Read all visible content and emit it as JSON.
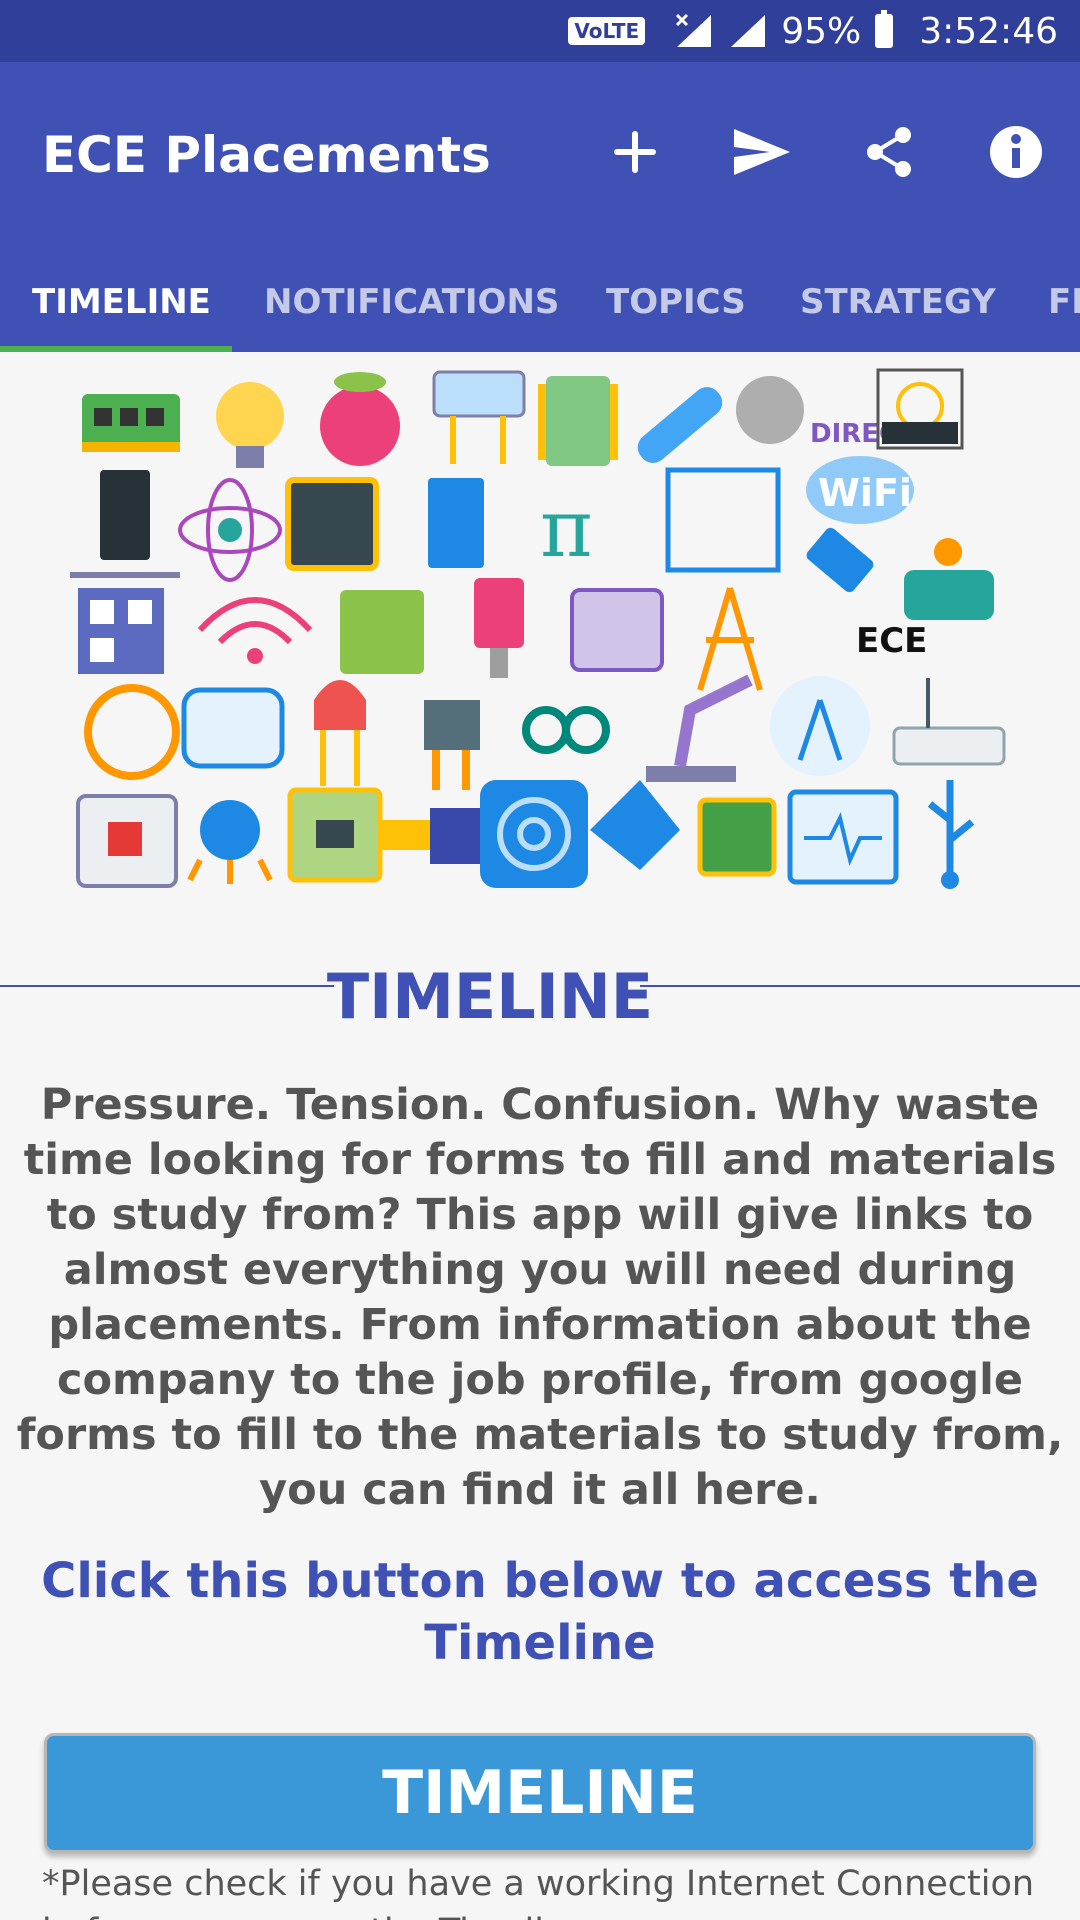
{
  "status_bar": {
    "volte": "VoLTE",
    "battery": "95%",
    "time": "3:52:46"
  },
  "app_bar": {
    "title": "ECE Placements",
    "actions": [
      "add-icon",
      "send-icon",
      "share-icon",
      "info-icon"
    ]
  },
  "tabs": [
    {
      "label": "TIMELINE",
      "active": true
    },
    {
      "label": "NOTIFICATIONS",
      "active": false
    },
    {
      "label": "TOPICS",
      "active": false
    },
    {
      "label": "STRATEGY",
      "active": false
    },
    {
      "label": "FE",
      "active": false
    }
  ],
  "hero": {
    "labels": {
      "wifi_direct": "DIRECT",
      "wifi": "WiFi",
      "ece": "ECE"
    }
  },
  "section": {
    "title": "TIMELINE",
    "description": "Pressure. Tension. Confusion. Why waste time looking for forms to fill and materials to study from? This app will give links to almost everything you will need during placements. From information about the company to the job profile, from google forms to fill to the materials to study from, you can find it all here."
  },
  "cta": {
    "prompt": "Click this button below to access the Timeline",
    "button_label": "TIMELINE",
    "note": "*Please check if you have a working Internet Connection before you access the Timeline"
  },
  "colors": {
    "status_bar": "#30409a",
    "app_bar": "#3f51b5",
    "tab_indicator": "#4caf50",
    "button": "#3a98d8"
  }
}
